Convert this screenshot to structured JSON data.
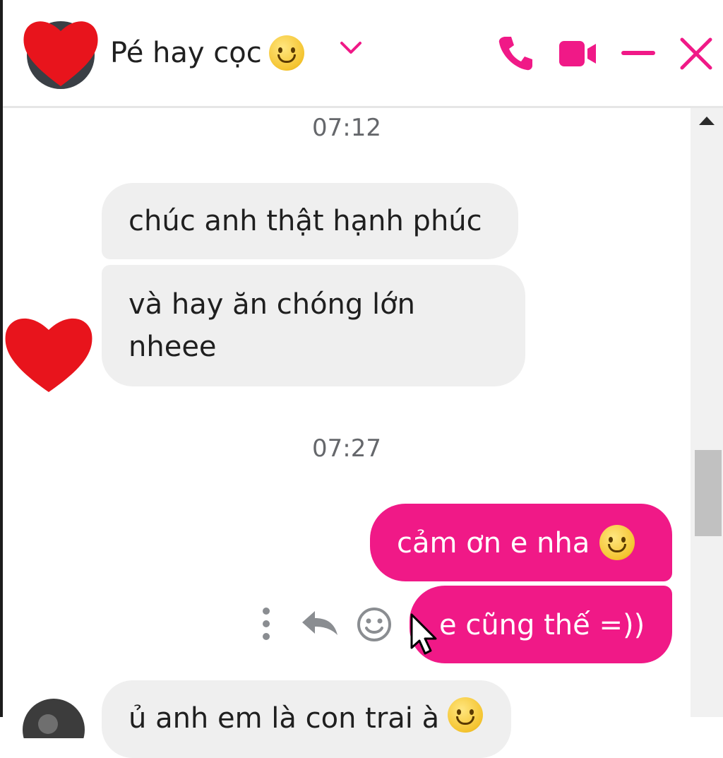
{
  "header": {
    "contact_name": "Pé hay cọc",
    "name_emoji": "smiling-face-emoji",
    "icons": [
      "chevron-down-icon",
      "phone-icon",
      "video-camera-icon",
      "minimize-icon",
      "close-icon"
    ],
    "accent_color": "#f01987"
  },
  "messages": {
    "time_1": "07:12",
    "msg_1": "chúc anh thật hạnh phúc",
    "msg_2_line1": "và hay ăn chóng lớn",
    "msg_2_line2": "nheee",
    "time_2": "07:27",
    "msg_3": "cảm ơn e nha",
    "msg_4": "e cũng thế =))",
    "msg_5_partial": "ủ anh em là con trai à"
  },
  "message_actions": [
    "more-options-icon",
    "reply-icon",
    "react-emoji-icon"
  ],
  "colors": {
    "incoming_bubble": "#efefef",
    "outgoing_bubble": "#f01987",
    "avatar_heart": "#e8141c"
  }
}
